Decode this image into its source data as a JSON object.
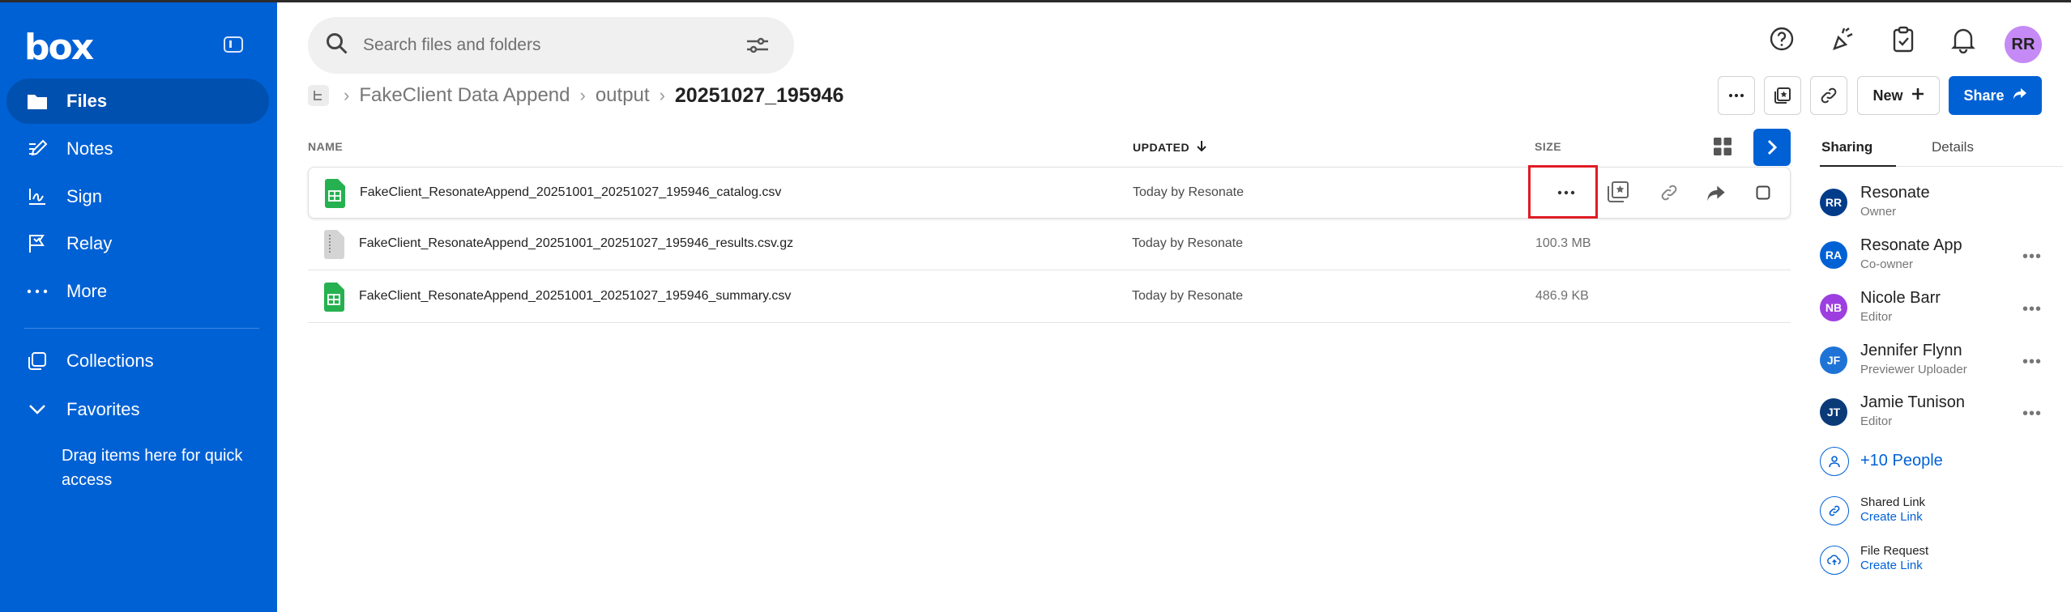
{
  "app": {
    "logo": "box"
  },
  "sidebar": {
    "items": [
      {
        "label": "Files",
        "active": true
      },
      {
        "label": "Notes"
      },
      {
        "label": "Sign"
      },
      {
        "label": "Relay"
      },
      {
        "label": "More"
      },
      {
        "label": "Collections"
      },
      {
        "label": "Favorites"
      }
    ],
    "drag_hint": "Drag items here for quick access"
  },
  "search": {
    "placeholder": "Search files and folders"
  },
  "user": {
    "initials": "RR"
  },
  "breadcrumb": {
    "items": [
      "FakeClient Data Append",
      "output"
    ],
    "current": "20251027_195946"
  },
  "toolbar": {
    "new_label": "New",
    "share_label": "Share"
  },
  "table": {
    "columns": {
      "name": "NAME",
      "updated": "UPDATED",
      "size": "SIZE"
    },
    "rows": [
      {
        "name": "FakeClient_ResonateAppend_20251001_20251027_195946_catalog.csv",
        "updated": "Today by Resonate",
        "size": "",
        "icon": "spreadsheet-icon"
      },
      {
        "name": "FakeClient_ResonateAppend_20251001_20251027_195946_results.csv.gz",
        "updated": "Today by Resonate",
        "size": "100.3 MB",
        "icon": "archive-file-icon"
      },
      {
        "name": "FakeClient_ResonateAppend_20251001_20251027_195946_summary.csv",
        "updated": "Today by Resonate",
        "size": "486.9 KB",
        "icon": "spreadsheet-icon"
      }
    ]
  },
  "right_panel": {
    "tabs": [
      "Sharing",
      "Details"
    ],
    "people": [
      {
        "initials": "RR",
        "name": "Resonate",
        "role": "Owner",
        "color": "#003c8a"
      },
      {
        "initials": "RA",
        "name": "Resonate App",
        "role": "Co-owner",
        "color": "#0061d5"
      },
      {
        "initials": "NB",
        "name": "Nicole Barr",
        "role": "Editor",
        "color": "#9d3fe0"
      },
      {
        "initials": "JF",
        "name": "Jennifer Flynn",
        "role": "Previewer Uploader",
        "color": "#1f73d6"
      },
      {
        "initials": "JT",
        "name": "Jamie Tunison",
        "role": "Editor",
        "color": "#0b3a79"
      }
    ],
    "more_people": "+10 People",
    "shared_link": {
      "title": "Shared Link",
      "action": "Create Link"
    },
    "file_request": {
      "title": "File Request",
      "action": "Create Link"
    }
  },
  "colors": {
    "brand": "#0061d5",
    "highlight": "#e01b24"
  }
}
